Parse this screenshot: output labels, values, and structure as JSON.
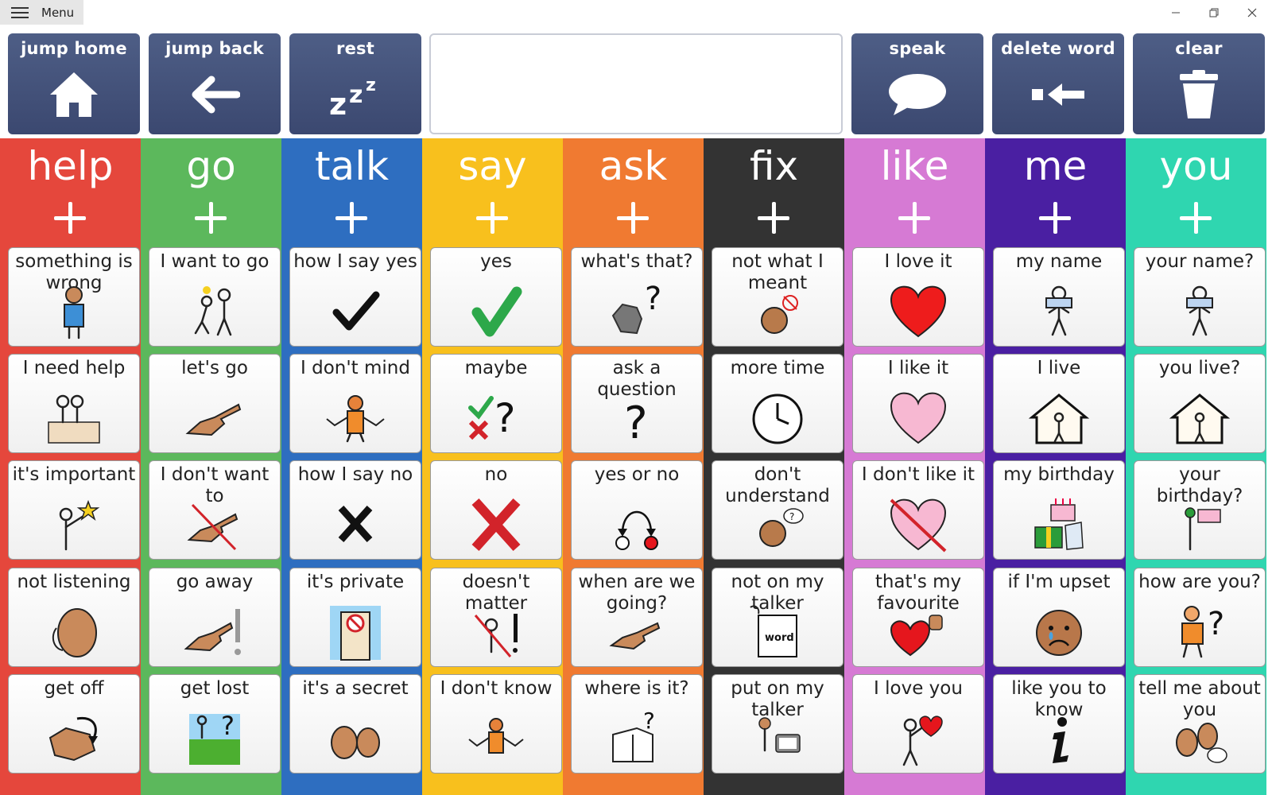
{
  "titlebar": {
    "menu_label": "Menu",
    "icons": [
      "hamburger-icon",
      "minimize-icon",
      "restore-icon",
      "close-icon"
    ]
  },
  "toolbar": {
    "jump_home": "jump home",
    "jump_back": "jump back",
    "rest": "rest",
    "speak": "speak",
    "delete_word": "delete word",
    "clear": "clear",
    "message_value": ""
  },
  "columns": [
    {
      "word": "help",
      "color": "#e5473c",
      "cells": [
        "something is wrong",
        "I need help",
        "it's important",
        "not listening",
        "get off"
      ]
    },
    {
      "word": "go",
      "color": "#5cb85c",
      "cells": [
        "I want to go",
        "let's go",
        "I don't want to",
        "go away",
        "get lost"
      ]
    },
    {
      "word": "talk",
      "color": "#2e6ec0",
      "cells": [
        "how I say yes",
        "I don't mind",
        "how I say no",
        "it's private",
        "it's a secret"
      ]
    },
    {
      "word": "say",
      "color": "#f8c01d",
      "cells": [
        "yes",
        "maybe",
        "no",
        "doesn't matter",
        "I don't know"
      ]
    },
    {
      "word": "ask",
      "color": "#f07a31",
      "cells": [
        "what's that?",
        "ask a question",
        "yes or no",
        "when are we going?",
        "where is it?"
      ]
    },
    {
      "word": "fix",
      "color": "#333333",
      "cells": [
        "not what I meant",
        "more time",
        "don't understand",
        "not on my talker",
        "put on my talker"
      ]
    },
    {
      "word": "like",
      "color": "#d67ad4",
      "cells": [
        "I love it",
        "I like it",
        "I don't like it",
        "that's my favourite",
        "I love you"
      ]
    },
    {
      "word": "me",
      "color": "#4a1fa2",
      "cells": [
        "my name",
        "I live",
        "my birthday",
        "if I'm upset",
        "like you to know"
      ]
    },
    {
      "word": "you",
      "color": "#2fd6b0",
      "cells": [
        "your name?",
        "you live?",
        "your birthday?",
        "how are you?",
        "tell me about you"
      ]
    }
  ],
  "word_label": "word"
}
